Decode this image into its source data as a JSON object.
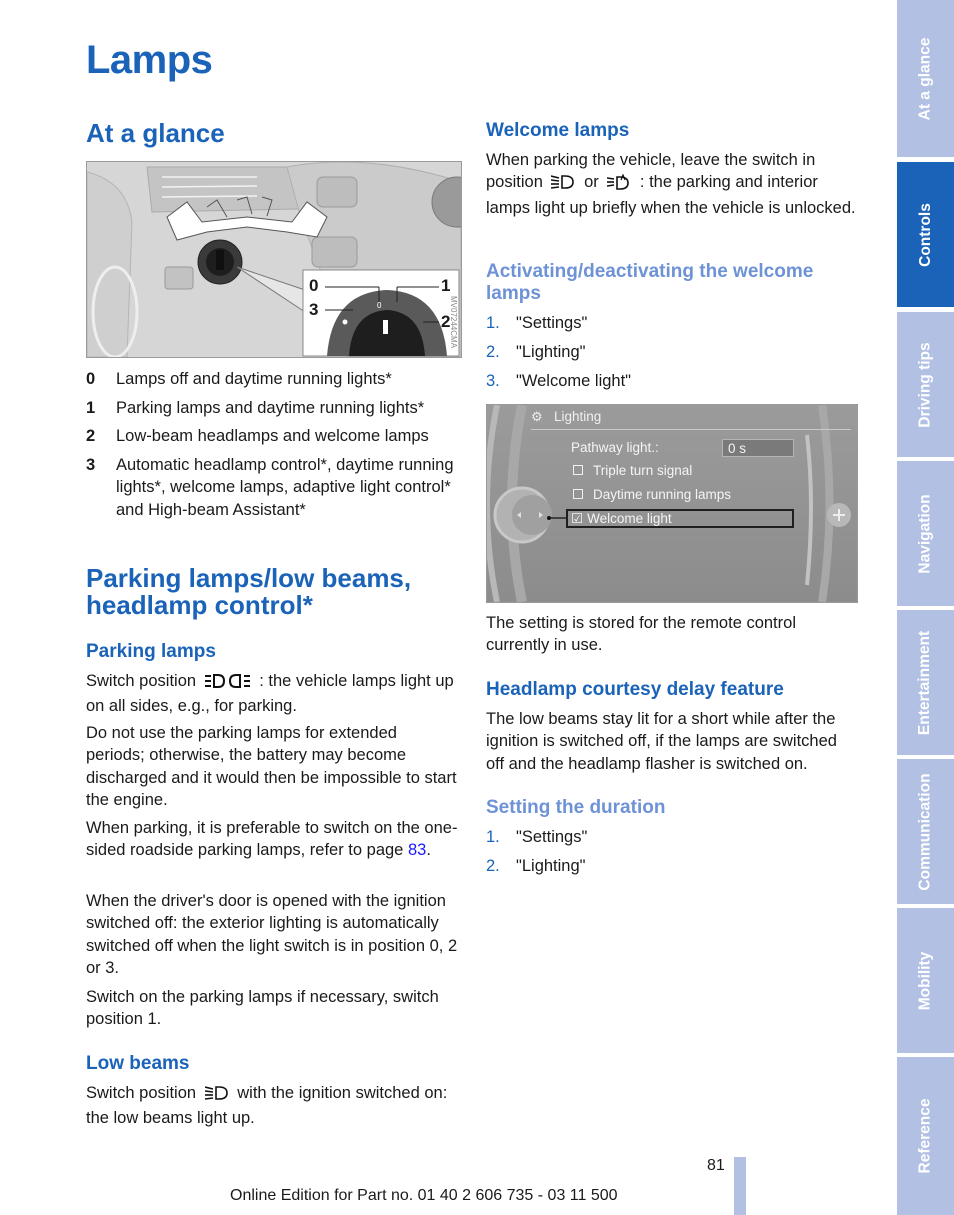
{
  "page": {
    "title": "Lamps",
    "page_number": "81",
    "footer": "Online Edition for Part no. 01 40 2 606 735 - 03 11 500"
  },
  "left_column": {
    "at_a_glance": {
      "heading": "At a glance",
      "figure": {
        "code": "MV07244CMA",
        "callouts": [
          "0",
          "1",
          "2",
          "3"
        ],
        "dial_marks": [
          "0"
        ]
      },
      "legend": [
        {
          "num": "0",
          "text": "Lamps off and daytime running lights*"
        },
        {
          "num": "1",
          "text": "Parking lamps and daytime running lights*"
        },
        {
          "num": "2",
          "text": "Low-beam headlamps and welcome lamps"
        },
        {
          "num": "3",
          "text": "Automatic headlamp control*, daytime running lights*, welcome lamps, adaptive light control* and High-beam Assistant*"
        }
      ]
    },
    "parking_section": {
      "heading": "Parking lamps/low beams, headlamp control*",
      "parking_lamps": {
        "heading": "Parking lamps",
        "p1_before": "Switch position",
        "p1_after": ": the vehicle lamps light up on all sides, e.g., for parking.",
        "p2": "Do not use the parking lamps for extended periods; otherwise, the battery may become discharged and it would then be impossible to start the engine.",
        "p3_before": "When parking, it is preferable to switch on the one-sided roadside parking lamps, refer to page",
        "p3_link": "83",
        "p3_after": ".",
        "p4": "When the driver's door is opened with the ignition switched off: the exterior lighting is automatically switched off when the light switch is in position 0, 2 or 3.",
        "p5": "Switch on the parking lamps if necessary, switch position 1."
      },
      "low_beams": {
        "heading": "Low beams",
        "p1_before": "Switch position",
        "p1_after": "with the ignition switched on: the low beams light up."
      }
    }
  },
  "right_column": {
    "welcome_lamps": {
      "heading": "Welcome lamps",
      "p1_before": "When parking the vehicle, leave the switch in position",
      "p1_or": "or",
      "p1_after": ": the parking and interior lamps light up briefly when the vehicle is unlocked."
    },
    "activating": {
      "heading": "Activating/deactivating the welcome lamps",
      "steps": [
        {
          "num": "1.",
          "text": "\"Settings\""
        },
        {
          "num": "2.",
          "text": "\"Lighting\""
        },
        {
          "num": "3.",
          "text": "\"Welcome light\""
        }
      ]
    },
    "idrive_screen": {
      "title": "Lighting",
      "pathway_label": "Pathway light.:",
      "pathway_value": "0 s",
      "options": [
        {
          "label": "Triple turn signal",
          "checked": false
        },
        {
          "label": "Daytime running lamps",
          "checked": false
        },
        {
          "label": "Welcome light",
          "checked": true,
          "selected": true
        }
      ]
    },
    "stored_note": "The setting is stored for the remote control currently in use.",
    "courtesy": {
      "heading": "Headlamp courtesy delay feature",
      "p1": "The low beams stay lit for a short while after the ignition is switched off, if the lamps are switched off and the headlamp flasher is switched on."
    },
    "duration": {
      "heading": "Setting the duration",
      "steps": [
        {
          "num": "1.",
          "text": "\"Settings\""
        },
        {
          "num": "2.",
          "text": "\"Lighting\""
        }
      ]
    }
  },
  "sidebar": {
    "tabs": [
      {
        "label": "At a glance",
        "active": false
      },
      {
        "label": "Controls",
        "active": true
      },
      {
        "label": "Driving tips",
        "active": false
      },
      {
        "label": "Navigation",
        "active": false
      },
      {
        "label": "Entertainment",
        "active": false
      },
      {
        "label": "Communication",
        "active": false
      },
      {
        "label": "Mobility",
        "active": false
      },
      {
        "label": "Reference",
        "active": false
      }
    ]
  },
  "colors": {
    "heading_blue": "#1a63b8",
    "subheading_light_blue": "#6d92d6",
    "sidebar_inactive": "#b1c0e3",
    "sidebar_active": "#1a63b8",
    "link": "#1a1aff"
  }
}
